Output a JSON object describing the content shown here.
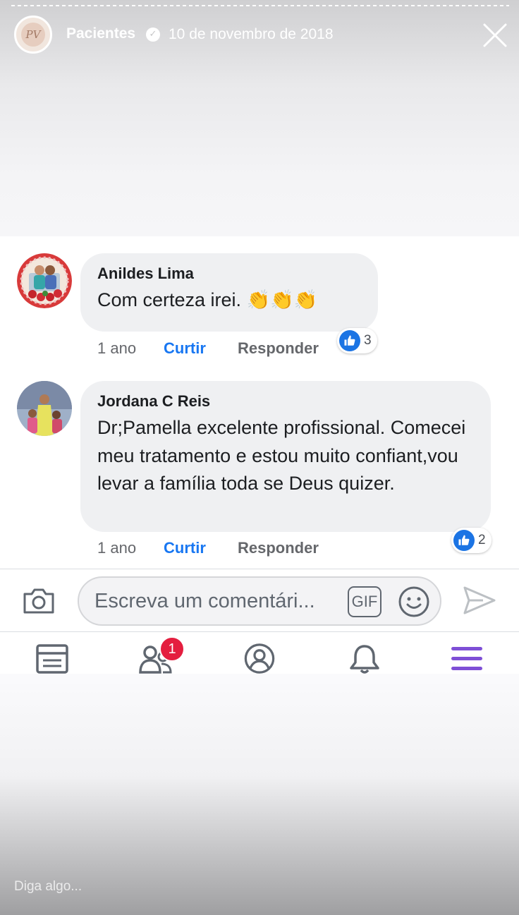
{
  "story": {
    "name": "Pacientes",
    "date": "10 de novembro de 2018",
    "avatar_monogram": "PV",
    "footer_prompt": "Diga algo..."
  },
  "comments": [
    {
      "author": "Anildes Lima",
      "text": "Com certeza irei. 👏👏👏",
      "time": "1 ano",
      "like_label": "Curtir",
      "reply_label": "Responder",
      "reactions": "3"
    },
    {
      "author": "Jordana C Reis",
      "text": "Dr;Pamella excelente profissional. Comecei meu tratamento e estou muito confiant,vou levar a família toda se Deus quizer.",
      "time": "1 ano",
      "like_label": "Curtir",
      "reply_label": "Responder",
      "reactions": "2"
    }
  ],
  "composer": {
    "placeholder": "Escreva um comentári...",
    "gif_label": "GIF"
  },
  "tabbar": {
    "friends_badge": "1"
  },
  "colors": {
    "like_blue": "#1877f2",
    "bubble_gray": "#eff0f2",
    "badge_red": "#e41e3f",
    "menu_purple": "#7e4fd6"
  },
  "icons": [
    "verified-icon",
    "close-icon",
    "like-icon",
    "camera-icon",
    "gif-icon",
    "emoji-icon",
    "send-icon",
    "feed-icon",
    "friends-icon",
    "profile-icon",
    "bell-icon",
    "menu-icon"
  ]
}
